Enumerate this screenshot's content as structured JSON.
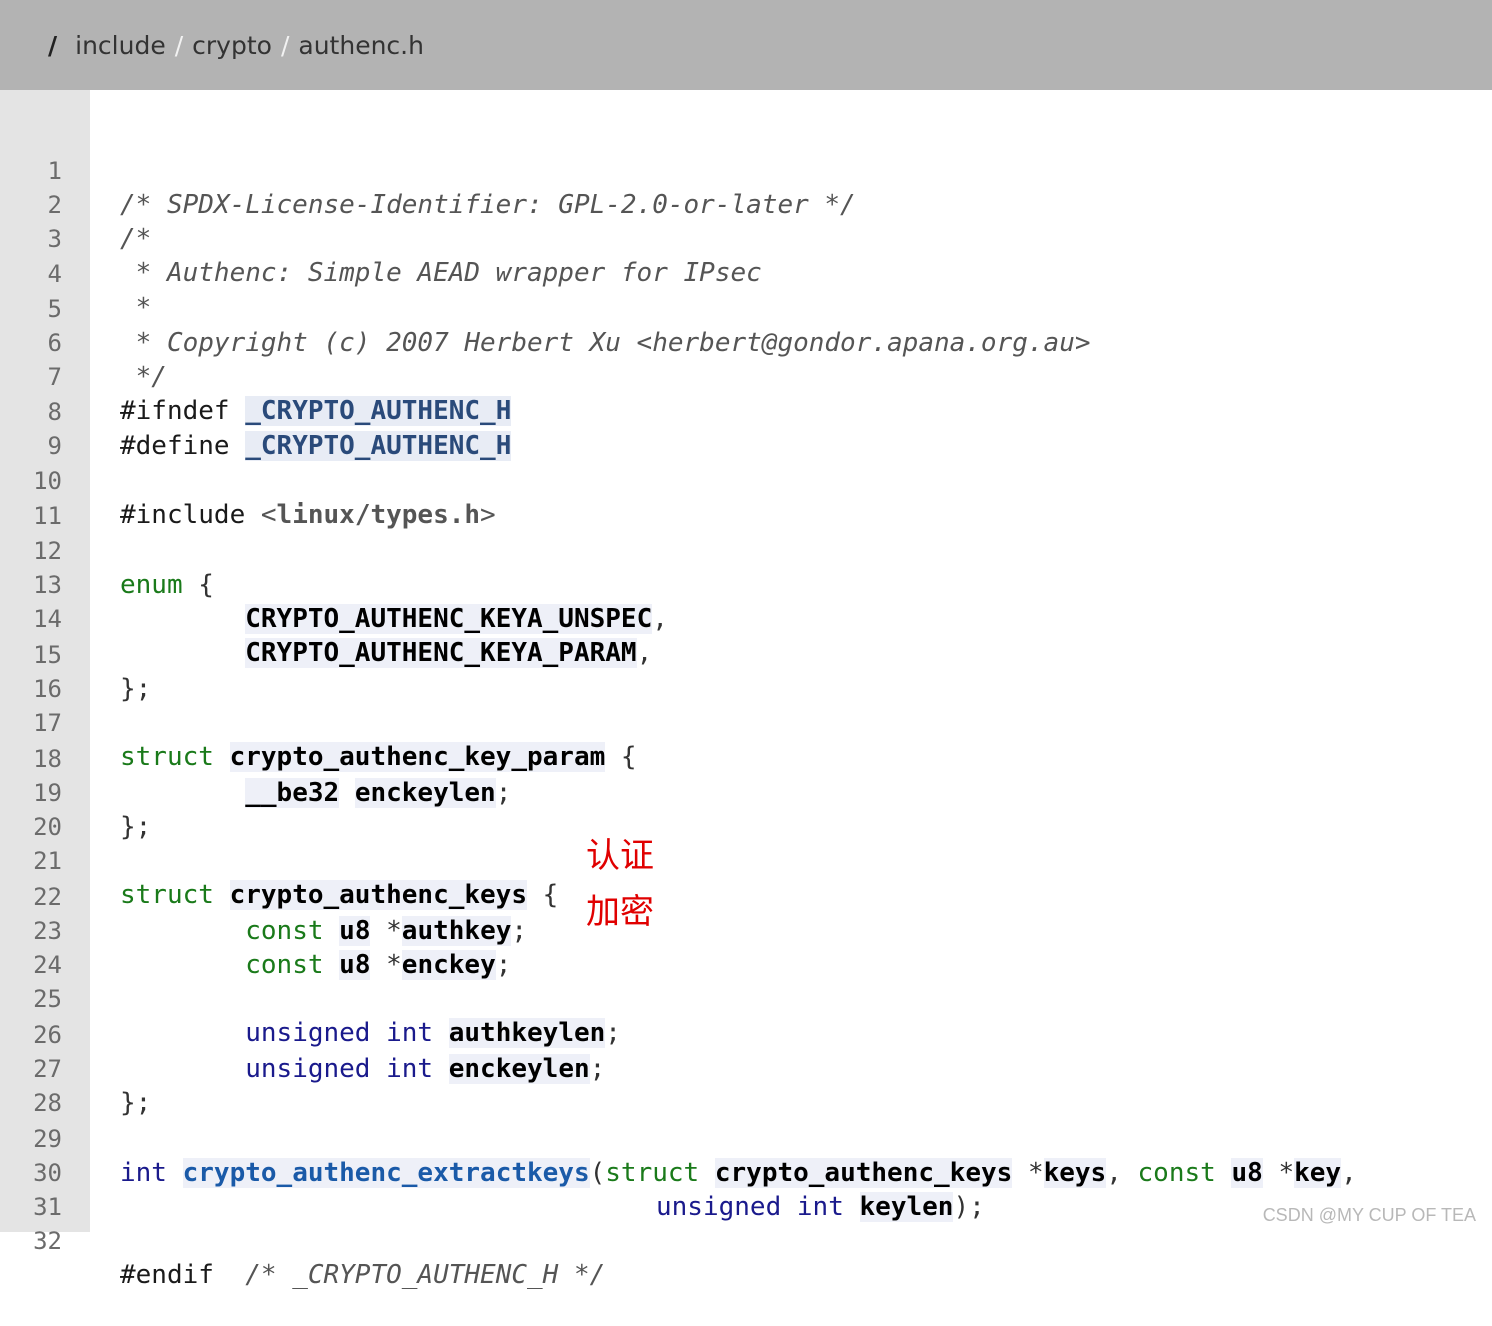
{
  "breadcrumb": {
    "root": "/",
    "separator": "/",
    "items": [
      "include",
      "crypto",
      "authenc.h"
    ]
  },
  "line_numbers": [
    "1",
    "2",
    "3",
    "4",
    "5",
    "6",
    "7",
    "8",
    "9",
    "10",
    "11",
    "12",
    "13",
    "14",
    "15",
    "16",
    "17",
    "18",
    "19",
    "20",
    "21",
    "22",
    "23",
    "24",
    "25",
    "26",
    "27",
    "28",
    "29",
    "30",
    "31",
    "32"
  ],
  "code": {
    "l1": "/* SPDX-License-Identifier: GPL-2.0-or-later */",
    "l2": "/*",
    "l3": " * Authenc: Simple AEAD wrapper for IPsec",
    "l4": " *",
    "l5": " * Copyright (c) 2007 Herbert Xu <herbert@gondor.apana.org.au>",
    "l6": " */",
    "ifndef": "#ifndef",
    "define": "#define",
    "guard_macro": "_CRYPTO_AUTHENC_H",
    "include": "#include",
    "include_open": "<",
    "include_path": "linux/types.h",
    "include_close": ">",
    "enum_kw": "enum",
    "open_brace": "{",
    "close_brace": "};",
    "enum_items": [
      "CRYPTO_AUTHENC_KEYA_UNSPEC",
      "CRYPTO_AUTHENC_KEYA_PARAM"
    ],
    "comma": ",",
    "semicolon": ";",
    "struct_kw": "struct",
    "param_struct": "crypto_authenc_key_param",
    "be32": "__be32",
    "enckeylen": "enckeylen",
    "keys_struct": "crypto_authenc_keys",
    "const_kw": "const",
    "u8": "u8",
    "star": "*",
    "authkey": "authkey",
    "enckey": "enckey",
    "unsigned_kw": "unsigned",
    "int_kw": "int",
    "authkeylen": "authkeylen",
    "func_name": "crypto_authenc_extractkeys",
    "paren_open": "(",
    "paren_close": ");",
    "keys_param": "keys",
    "key_param": "key",
    "keylen_param": "keylen",
    "endif": "#endif",
    "endif_comment": "/* _CRYPTO_AUTHENC_H */"
  },
  "annotations": {
    "authkey_note": "认证",
    "enckey_note": "加密"
  },
  "watermark": "CSDN @MY CUP OF TEA"
}
